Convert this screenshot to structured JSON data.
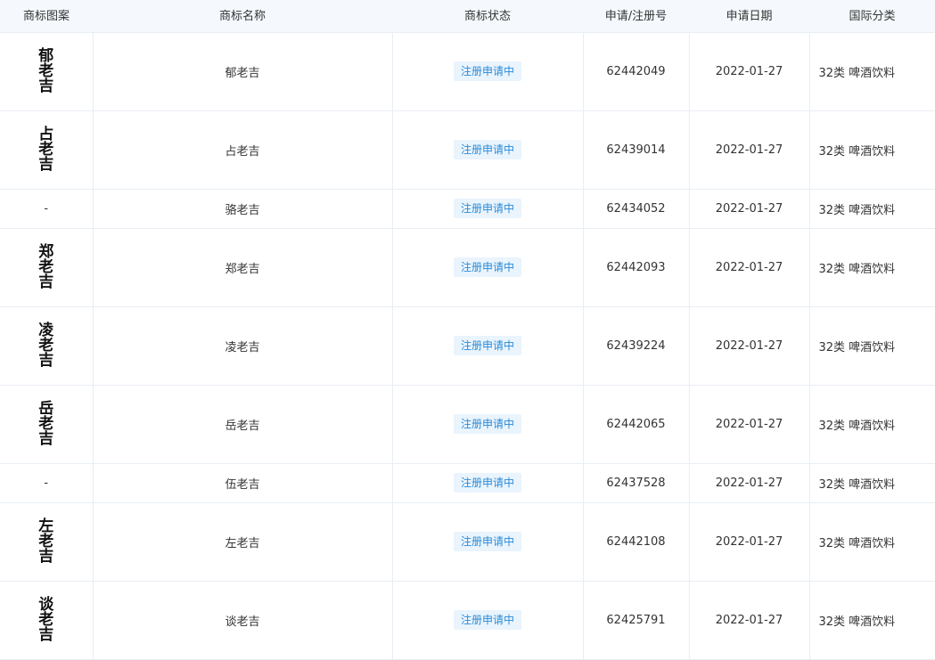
{
  "columns": {
    "image": "商标图案",
    "name": "商标名称",
    "status": "商标状态",
    "regno": "申请/注册号",
    "date": "申请日期",
    "class": "国际分类"
  },
  "rows": [
    {
      "image": "郁老吉",
      "name": "郁老吉",
      "status": "注册申请中",
      "regno": "62442049",
      "date": "2022-01-27",
      "class": "32类 啤酒饮料"
    },
    {
      "image": "占老吉",
      "name": "占老吉",
      "status": "注册申请中",
      "regno": "62439014",
      "date": "2022-01-27",
      "class": "32类 啤酒饮料"
    },
    {
      "image": "-",
      "name": "骆老吉",
      "status": "注册申请中",
      "regno": "62434052",
      "date": "2022-01-27",
      "class": "32类 啤酒饮料"
    },
    {
      "image": "郑老吉",
      "name": "郑老吉",
      "status": "注册申请中",
      "regno": "62442093",
      "date": "2022-01-27",
      "class": "32类 啤酒饮料"
    },
    {
      "image": "凌老吉",
      "name": "凌老吉",
      "status": "注册申请中",
      "regno": "62439224",
      "date": "2022-01-27",
      "class": "32类 啤酒饮料"
    },
    {
      "image": "岳老吉",
      "name": "岳老吉",
      "status": "注册申请中",
      "regno": "62442065",
      "date": "2022-01-27",
      "class": "32类 啤酒饮料"
    },
    {
      "image": "-",
      "name": "伍老吉",
      "status": "注册申请中",
      "regno": "62437528",
      "date": "2022-01-27",
      "class": "32类 啤酒饮料"
    },
    {
      "image": "左老吉",
      "name": "左老吉",
      "status": "注册申请中",
      "regno": "62442108",
      "date": "2022-01-27",
      "class": "32类 啤酒饮料"
    },
    {
      "image": "谈老吉",
      "name": "谈老吉",
      "status": "注册申请中",
      "regno": "62425791",
      "date": "2022-01-27",
      "class": "32类 啤酒饮料"
    }
  ],
  "colors": {
    "header_bg": "#f5f9fd",
    "badge_bg": "#eaf4fd",
    "badge_text": "#2a8bd8",
    "border": "#e8eef5"
  }
}
